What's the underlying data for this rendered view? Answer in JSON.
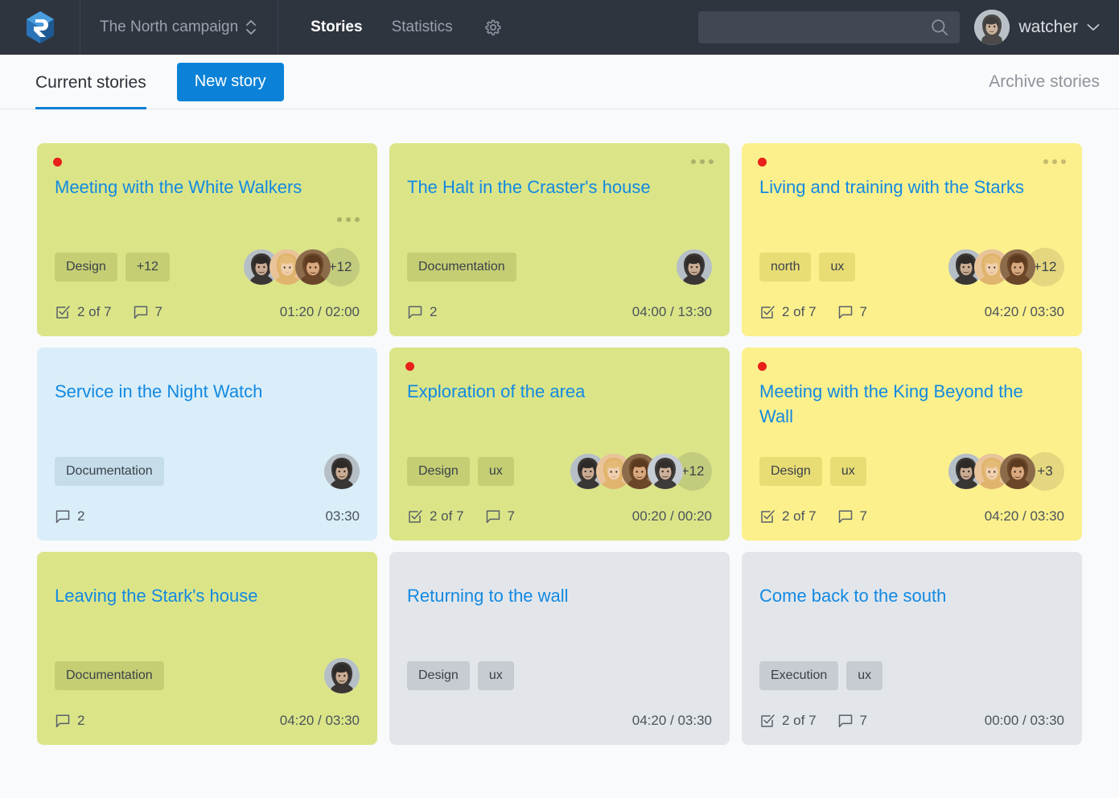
{
  "header": {
    "logo_icon": "app-logo-hexagon-r",
    "campaign": "The North campaign",
    "campaign_icon": "updown-chevron-icon",
    "nav": [
      {
        "label": "Stories",
        "active": true
      },
      {
        "label": "Statistics",
        "active": false
      }
    ],
    "settings_icon": "gear-icon",
    "search": {
      "value": "",
      "placeholder": "",
      "icon": "search-icon"
    },
    "user": {
      "name": "watcher",
      "avatar": "user-avatar",
      "chevron": "chevron-down-icon"
    }
  },
  "subheader": {
    "tab_current": "Current stories",
    "new_story": "New story",
    "archive": "Archive stories"
  },
  "cards": [
    {
      "title": "Meeting with the White Walkers",
      "color": "green",
      "dot": true,
      "menu": "mid",
      "tags": [
        "Design",
        "+12"
      ],
      "avatars": 3,
      "avatar_more": "+12",
      "tasks": "2 of 7",
      "comments": "7",
      "time": "01:20 / 02:00"
    },
    {
      "title": "The Halt in the Craster's house",
      "color": "green",
      "dot": false,
      "menu": "top",
      "tags": [
        "Documentation"
      ],
      "avatars": 1,
      "avatar_more": "",
      "tasks": "",
      "comments": "2",
      "time": "04:00 / 13:30"
    },
    {
      "title": "Living and training with the Starks",
      "color": "yellow",
      "dot": true,
      "menu": "top",
      "tags": [
        "north",
        "ux"
      ],
      "avatars": 3,
      "avatar_more": "+12",
      "tasks": "2 of 7",
      "comments": "7",
      "time": "04:20 / 03:30"
    },
    {
      "title": "Service in the Night Watch",
      "color": "blue",
      "dot": false,
      "menu": "none",
      "tags": [
        "Documentation"
      ],
      "avatars": 1,
      "avatar_more": "",
      "tasks": "",
      "comments": "2",
      "time": "03:30"
    },
    {
      "title": "Exploration of the area",
      "color": "green",
      "dot": true,
      "menu": "none",
      "tags": [
        "Design",
        "ux"
      ],
      "avatars": 4,
      "avatar_more": "+12",
      "tasks": "2 of 7",
      "comments": "7",
      "time": "00:20 / 00:20"
    },
    {
      "title": "Meeting with the King Beyond the Wall",
      "color": "yellow",
      "dot": true,
      "menu": "none",
      "tags": [
        "Design",
        "ux"
      ],
      "avatars": 3,
      "avatar_more": "+3",
      "tasks": "2 of 7",
      "comments": "7",
      "time": "04:20 / 03:30"
    },
    {
      "title": "Leaving the Stark's house",
      "color": "green",
      "dot": false,
      "menu": "none",
      "tags": [
        "Documentation"
      ],
      "avatars": 1,
      "avatar_more": "",
      "tasks": "",
      "comments": "2",
      "time": "04:20 / 03:30"
    },
    {
      "title": "Returning to the wall",
      "color": "gray",
      "dot": false,
      "menu": "none",
      "tags": [
        "Design",
        "ux"
      ],
      "avatars": 0,
      "avatar_more": "",
      "tasks": "",
      "comments": "",
      "time": "04:20 / 03:30"
    },
    {
      "title": "Come back to the south",
      "color": "gray",
      "dot": false,
      "menu": "none",
      "tags": [
        "Execution",
        "ux"
      ],
      "avatars": 0,
      "avatar_more": "",
      "tasks": "2 of 7",
      "comments": "7",
      "time": "00:00 / 03:30"
    }
  ],
  "colors": {
    "topbar": "#2f353f",
    "accent_blue": "#0b82d8",
    "title_blue": "#1389e2",
    "card_green": "#dbe588",
    "card_yellow": "#fbf08c",
    "card_blue": "#d9eef9",
    "card_gray": "#e2e6ea",
    "dot_red": "#e8201a"
  },
  "icons": {
    "tasks": "checkbox-check-icon",
    "comments": "comment-bubble-icon",
    "menu": "more-options-icon"
  }
}
